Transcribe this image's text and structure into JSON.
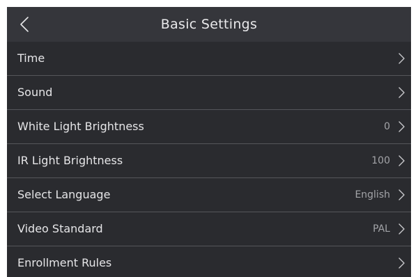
{
  "header": {
    "title": "Basic Settings",
    "back_icon": "chevron-left-icon"
  },
  "colors": {
    "background": "#2a2b2f",
    "header_background": "#35363b",
    "divider": "#55565b",
    "text_primary": "#e6e6e8",
    "text_secondary": "#a3a4a8"
  },
  "settings": [
    {
      "label": "Time",
      "value": "",
      "icon": "chevron-right-icon"
    },
    {
      "label": "Sound",
      "value": "",
      "icon": "chevron-right-icon"
    },
    {
      "label": "White Light Brightness",
      "value": "0",
      "icon": "chevron-right-icon"
    },
    {
      "label": "IR Light Brightness",
      "value": "100",
      "icon": "chevron-right-icon"
    },
    {
      "label": "Select Language",
      "value": "English",
      "icon": "chevron-right-icon"
    },
    {
      "label": "Video Standard",
      "value": "PAL",
      "icon": "chevron-right-icon"
    },
    {
      "label": "Enrollment Rules",
      "value": "",
      "icon": "chevron-right-icon"
    }
  ]
}
